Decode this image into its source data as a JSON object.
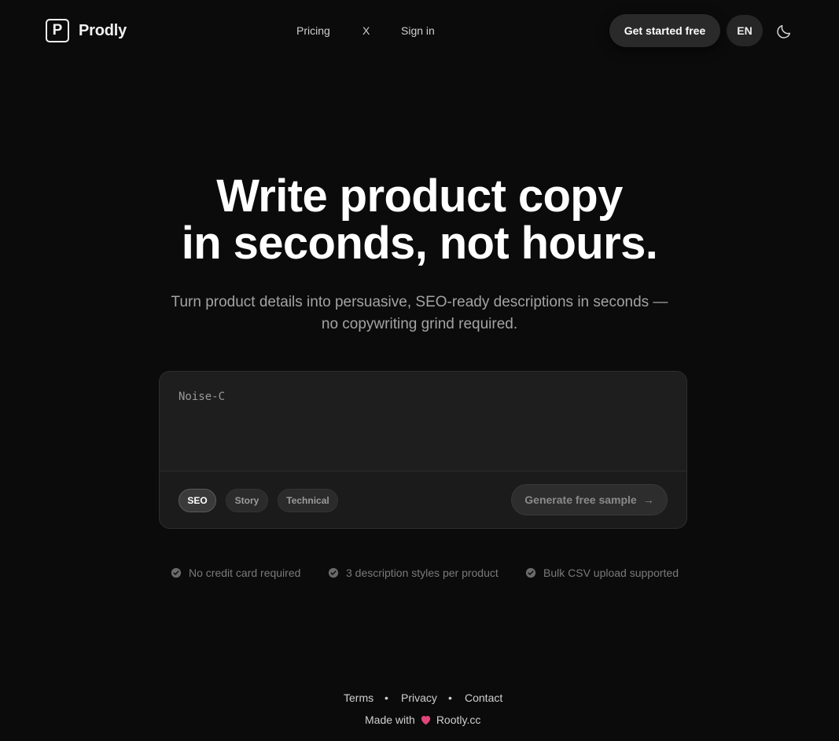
{
  "brand": {
    "logo_letter": "P",
    "name": "Prodly"
  },
  "nav": {
    "items": [
      "Pricing",
      "X",
      "Sign in"
    ]
  },
  "header": {
    "cta_label": "Get started free",
    "lang_label": "EN"
  },
  "hero": {
    "title_line1": "Write product copy",
    "title_line2": "in seconds, not hours.",
    "subtitle": "Turn product details into persuasive, SEO-ready descriptions in seconds — no copywriting grind required."
  },
  "composer": {
    "input_value": "",
    "input_placeholder": "Noise-C",
    "styles": [
      {
        "label": "SEO",
        "active": true
      },
      {
        "label": "Story",
        "active": false
      },
      {
        "label": "Technical",
        "active": false
      }
    ],
    "generate_label": "Generate free sample",
    "generate_arrow": "→"
  },
  "features": [
    "No credit card required",
    "3 description styles per product",
    "Bulk CSV upload supported"
  ],
  "footer": {
    "links": [
      "Terms",
      "Privacy",
      "Contact"
    ],
    "separator": "•",
    "made_with_prefix": "Made with",
    "made_with_brand": "Rootly.cc"
  },
  "colors": {
    "background": "#0b0b0b",
    "card": "#1b1b1b",
    "heart": "#e0457b",
    "muted": "#7a7a7a"
  }
}
